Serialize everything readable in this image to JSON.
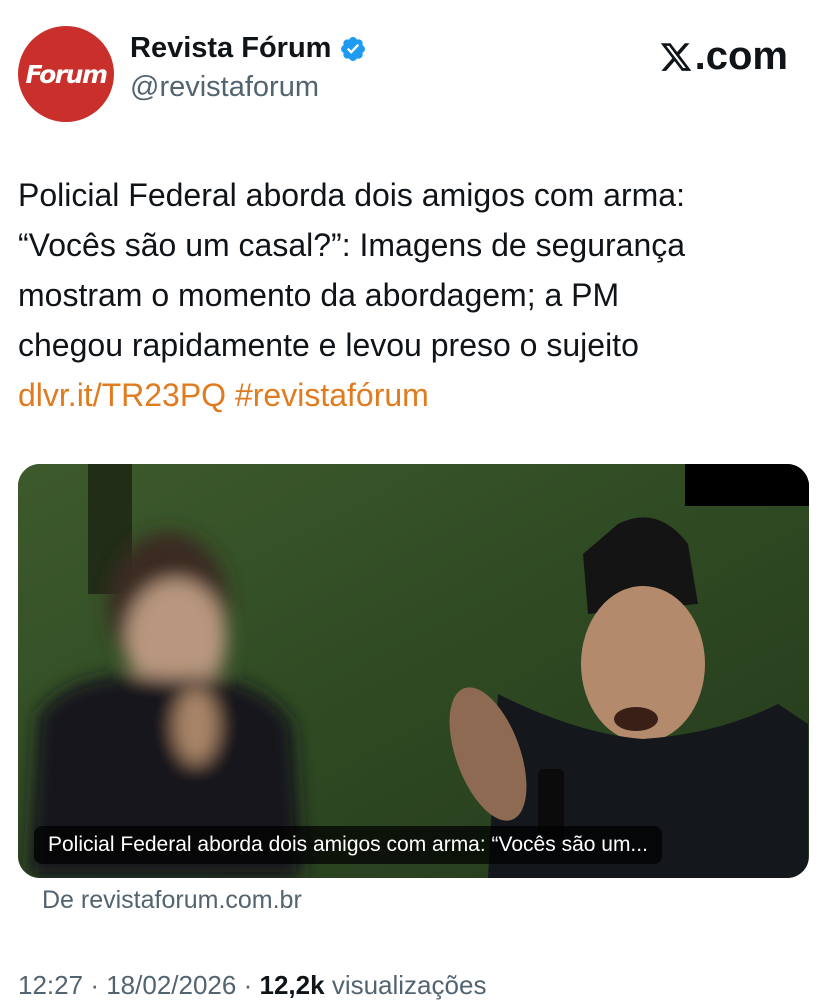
{
  "author": {
    "avatar_text": "Forum",
    "display_name": "Revista Fórum",
    "handle": "@revistaforum",
    "verified_icon": "verified-badge-icon",
    "avatar_color": "#c9302c"
  },
  "brand": {
    "domain_suffix": ".com",
    "icon": "x-logo-icon"
  },
  "tweet": {
    "lines": [
      "Policial Federal aborda dois amigos com arma:",
      "“Vocês são um casal?”: Imagens de segurança",
      "mostram o momento da abordagem; a PM",
      "chegou rapidamente e levou preso o sujeito"
    ],
    "link": "dlvr.it/TR23PQ",
    "hashtag": "#revistafórum",
    "link_color": "#e07b1f"
  },
  "media": {
    "caption": "Policial Federal aborda dois amigos com arma: “Vocês são um...",
    "source": "De revistaforum.com.br"
  },
  "meta": {
    "time": "12:27",
    "separator": "·",
    "date": "18/02/2026",
    "views_count": "12,2k",
    "views_label": "visualizações"
  }
}
